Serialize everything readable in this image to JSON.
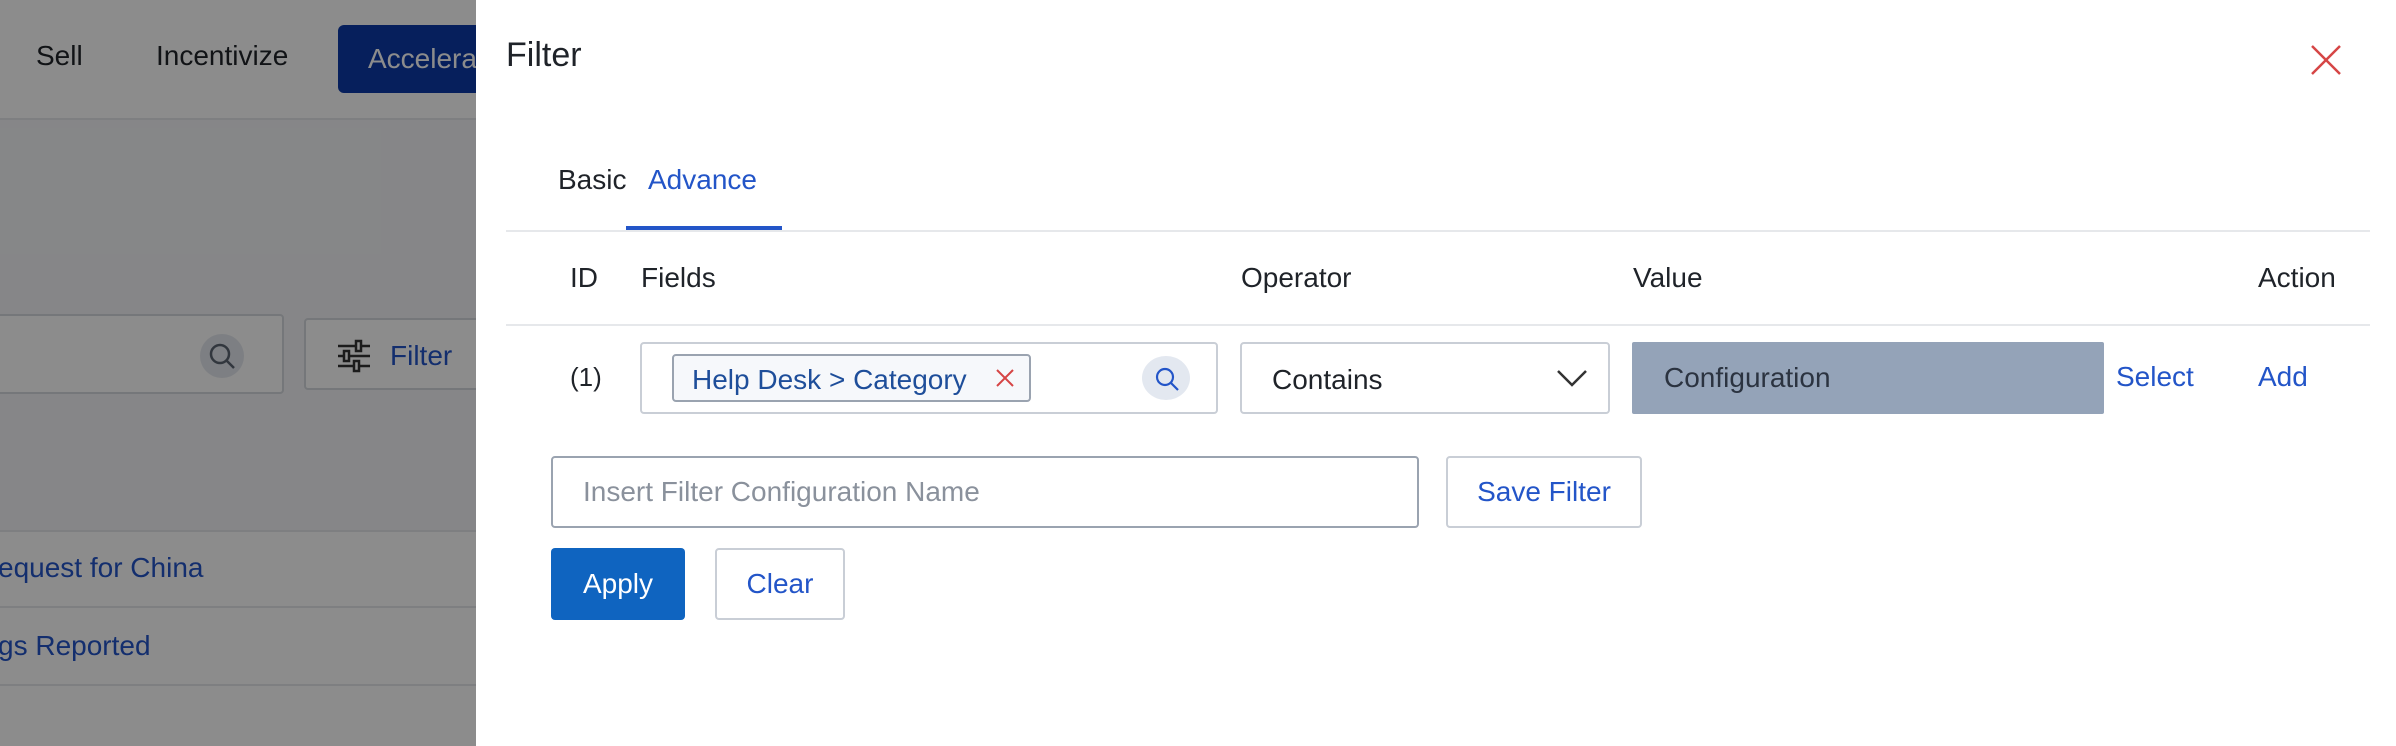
{
  "background": {
    "nav": {
      "items": [
        "Sell",
        "Incentivize"
      ],
      "active_item": "Accelera"
    },
    "filter_button_label": "Filter",
    "rows": [
      "equest for China",
      "gs Reported"
    ]
  },
  "drawer": {
    "title": "Filter",
    "tabs": [
      {
        "label": "Basic",
        "active": false
      },
      {
        "label": "Advance",
        "active": true
      }
    ],
    "table": {
      "columns": [
        "ID",
        "Fields",
        "Operator",
        "Value",
        "Action"
      ],
      "rows": [
        {
          "id": "(1)",
          "field_chip": "Help Desk > Category",
          "operator": "Contains",
          "value": "Configuration",
          "actions": [
            "Select",
            "Add"
          ]
        }
      ]
    },
    "config_name_placeholder": "Insert Filter Configuration Name",
    "save_filter_label": "Save Filter",
    "apply_label": "Apply",
    "clear_label": "Clear"
  },
  "colors": {
    "accent": "#2355c8",
    "primary_button": "#0f64c0",
    "close_icon": "#d64545",
    "value_fill": "#94a3b8"
  },
  "icons": [
    "search-icon",
    "filter-sliders-icon",
    "close-icon",
    "remove-chip-icon",
    "chevron-down-icon"
  ]
}
